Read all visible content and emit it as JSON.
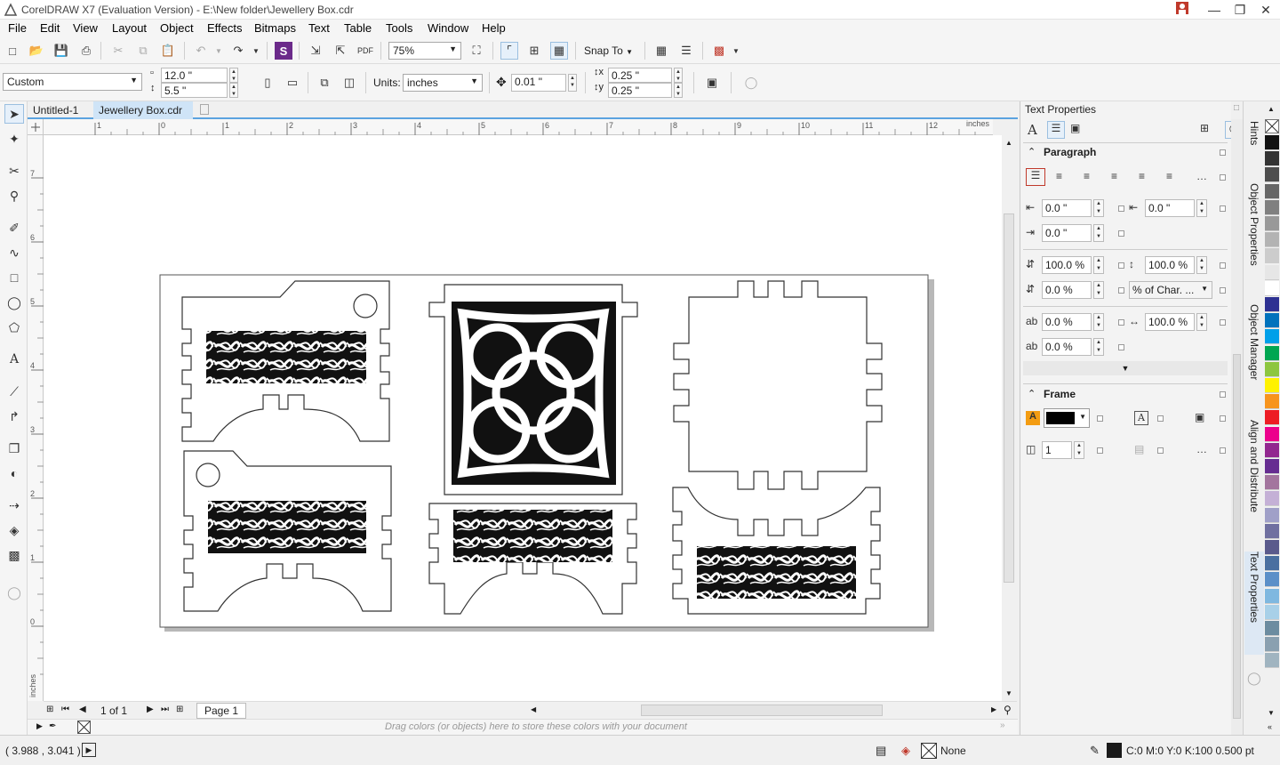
{
  "titlebar": {
    "title": "CorelDRAW X7 (Evaluation Version) - E:\\New folder\\Jewellery Box.cdr"
  },
  "menu": [
    "File",
    "Edit",
    "View",
    "Layout",
    "Object",
    "Effects",
    "Bitmaps",
    "Text",
    "Table",
    "Tools",
    "Window",
    "Help"
  ],
  "stdbar": {
    "zoom": "75%",
    "snap_to": "Snap To"
  },
  "propbar": {
    "page_preset": "Custom",
    "width": "12.0 \"",
    "height": "5.5 \"",
    "units_label": "Units:",
    "units": "inches",
    "nudge": "0.01 \"",
    "dup_x": "0.25 \"",
    "dup_y": "0.25 \""
  },
  "doctabs": [
    "Untitled-1",
    "Jewellery Box.cdr"
  ],
  "hruler": {
    "unit": "inches",
    "ticks": [
      "1",
      "0",
      "1",
      "2",
      "3",
      "4",
      "5",
      "6",
      "7",
      "8",
      "9",
      "10",
      "11",
      "12"
    ]
  },
  "vruler": {
    "ticks": [
      "7",
      "6",
      "5",
      "4",
      "3",
      "2",
      "1",
      "0"
    ],
    "unit": "inches"
  },
  "pagenav": {
    "page_count": "1 of 1",
    "page_tab": "Page 1"
  },
  "palettebar": {
    "hint": "Drag colors (or objects) here to store these colors with your document"
  },
  "status": {
    "coords": "( 3.988 , 3.041 )",
    "fill": "None",
    "outline": "C:0 M:0 Y:0 K:100  0.500 pt"
  },
  "docker": {
    "title": "Text Properties",
    "paragraph": {
      "header": "Paragraph",
      "left_indent": "0.0 \"",
      "first_line_indent": "0.0 \"",
      "right_indent": "0.0 \"",
      "line_spacing": "100.0 %",
      "char_spacing_pct": "100.0 %",
      "before_para": "0.0 %",
      "spacing_units": "% of Char. ...",
      "after_para": "0.0 %",
      "word_spacing": "100.0 %",
      "lang_spacing": "0.0 %"
    },
    "frame": {
      "header": "Frame",
      "columns": "1"
    },
    "tabs": [
      "Hints",
      "Object Properties",
      "Object Manager",
      "Align and Distribute",
      "Text Properties"
    ]
  },
  "palette_colors": [
    "#111111",
    "#333333",
    "#4d4d4d",
    "#666666",
    "#808080",
    "#999999",
    "#b3b3b3",
    "#cccccc",
    "#e6e6e6",
    "#ffffff",
    "#2e3192",
    "#0072bc",
    "#00a0e9",
    "#00a651",
    "#8dc63f",
    "#fff200",
    "#f7941d",
    "#ed1c24",
    "#ec008c",
    "#92278f",
    "#662d91",
    "#a3759e",
    "#c4b0d6",
    "#a0a0c8",
    "#7070a0",
    "#5a5a8c",
    "#4a6fa0",
    "#5b8fc8",
    "#7fb8e0",
    "#a8d0e8",
    "#6c8ca0",
    "#8aa0b0",
    "#a0b4c0"
  ]
}
